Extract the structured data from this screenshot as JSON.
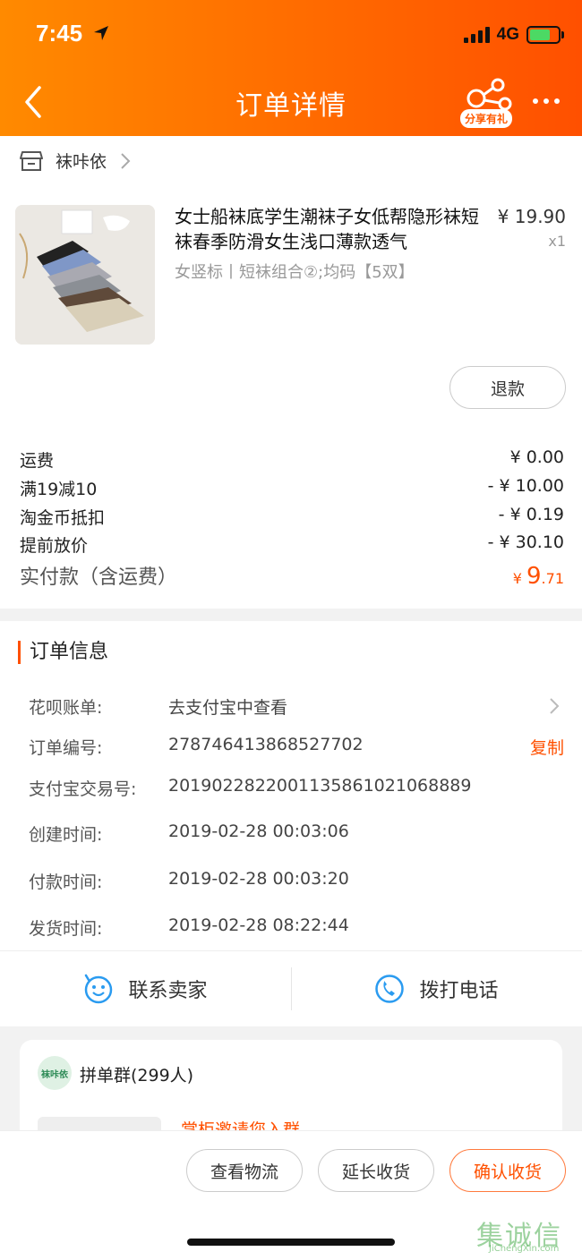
{
  "status": {
    "time": "7:45",
    "network": "4G"
  },
  "header": {
    "title": "订单详情",
    "share_label": "分享有礼"
  },
  "shop": {
    "name": "袜咔依"
  },
  "product": {
    "title": "女士船袜底学生潮袜子女低帮隐形袜短袜春季防滑女生浅口薄款透气",
    "price": "¥ 19.90",
    "qty": "x1",
    "sku": "女竖标丨短袜组合②;均码【5双】",
    "refund_label": "退款"
  },
  "fees": [
    {
      "label": "运费",
      "value": "¥ 0.00"
    },
    {
      "label": "满19减10",
      "value": "- ¥ 10.00"
    },
    {
      "label": "淘金币抵扣",
      "value": "- ¥ 0.19"
    },
    {
      "label": "提前放价",
      "value": "- ¥ 30.10"
    }
  ],
  "total": {
    "label": "实付款（含运费）",
    "currency": "¥ ",
    "integer": "9",
    "decimal": ".71"
  },
  "order_info": {
    "title": "订单信息",
    "rows": [
      {
        "label": "花呗账单:",
        "value": "去支付宝中查看"
      },
      {
        "label": "订单编号:",
        "value": "278746413868527702",
        "action": "复制"
      },
      {
        "label": "支付宝交易号:",
        "value": "2019022822001135861021068889"
      },
      {
        "label": "创建时间:",
        "value": "2019-02-28 00:03:06"
      },
      {
        "label": "付款时间:",
        "value": "2019-02-28 00:03:20"
      },
      {
        "label": "发货时间:",
        "value": "2019-02-28 08:22:44"
      }
    ]
  },
  "contact": {
    "seller_label": "联系卖家",
    "phone_label": "拨打电话"
  },
  "group": {
    "name": "拼单群(299人)",
    "avatar_text": "袜咔依",
    "message": "掌柜邀请您入群"
  },
  "actions": {
    "logistics": "查看物流",
    "extend": "延长收货",
    "confirm": "确认收货"
  },
  "watermark": {
    "text": "集诚信",
    "sub": "JiChengXin.com"
  },
  "colors": {
    "accent": "#ff5000",
    "header_start": "#ff8a00",
    "header_end": "#ff5000"
  }
}
